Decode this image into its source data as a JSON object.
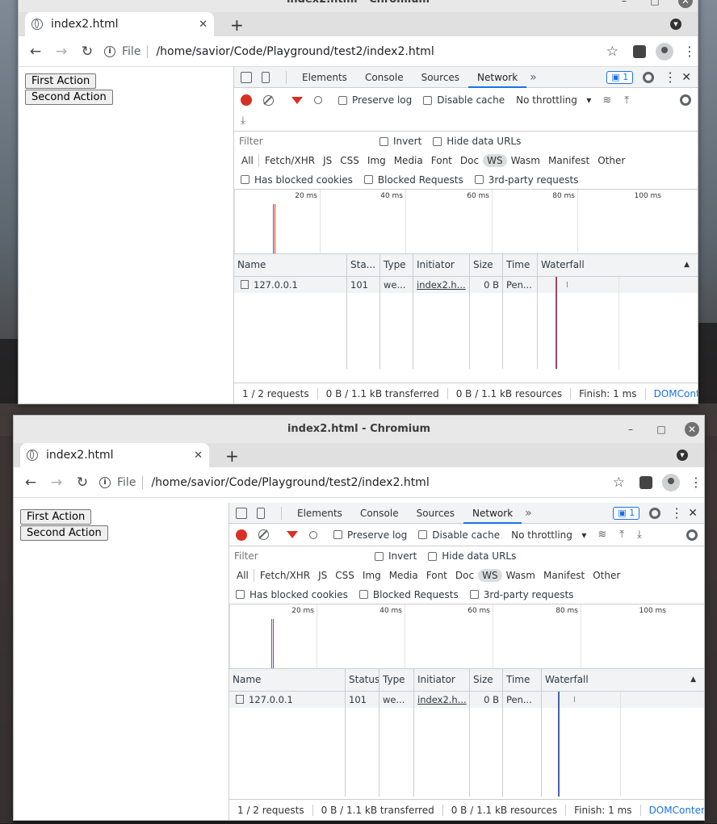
{
  "window_title": "index2.html - Chromium",
  "tab_title": "index2.html",
  "omnibox": {
    "scheme_label": "File",
    "url": "/home/savior/Code/Playground/test2/index2.html"
  },
  "page": {
    "first_action_label": "First Action",
    "second_action_label": "Second Action"
  },
  "devtools": {
    "tabs": [
      "Elements",
      "Console",
      "Sources",
      "Network"
    ],
    "active_tab": "Network",
    "more_tabs": "»",
    "message_count": "1",
    "toolbar": {
      "preserve_log": "Preserve log",
      "disable_cache": "Disable cache",
      "throttling": "No throttling"
    },
    "filter": {
      "placeholder": "Filter",
      "invert": "Invert",
      "hide_data_urls": "Hide data URLs"
    },
    "types": [
      "All",
      "Fetch/XHR",
      "JS",
      "CSS",
      "Img",
      "Media",
      "Font",
      "Doc",
      "WS",
      "Wasm",
      "Manifest",
      "Other"
    ],
    "selected_type": "WS",
    "blocked": {
      "blocked_cookies": "Has blocked cookies",
      "blocked_requests": "Blocked Requests",
      "third_party": "3rd-party requests"
    },
    "overview_ticks": [
      "20 ms",
      "40 ms",
      "60 ms",
      "80 ms",
      "100 ms"
    ],
    "columns_top": [
      "Name",
      "Sta...",
      "Type",
      "Initiator",
      "Size",
      "Time",
      "Waterfall"
    ],
    "columns_bottom": [
      "Name",
      "Status",
      "Type",
      "Initiator",
      "Size",
      "Time",
      "Waterfall"
    ],
    "row": {
      "name": "127.0.0.1",
      "status": "101",
      "type": "we...",
      "initiator": "index2.h...",
      "size": "0 B",
      "time": "Pen..."
    },
    "status": {
      "requests": "1 / 2 requests",
      "transferred": "0 B / 1.1 kB transferred",
      "resources": "0 B / 1.1 kB resources",
      "finish": "Finish: 1 ms",
      "dom_top": "DOMContentLoade",
      "dom_bottom": "DOMContentLoaded: "
    }
  },
  "colors": {
    "record": "#d93025",
    "active_tab_underline": "#1a73e8",
    "dom_content_loaded": "#1a73e8"
  }
}
